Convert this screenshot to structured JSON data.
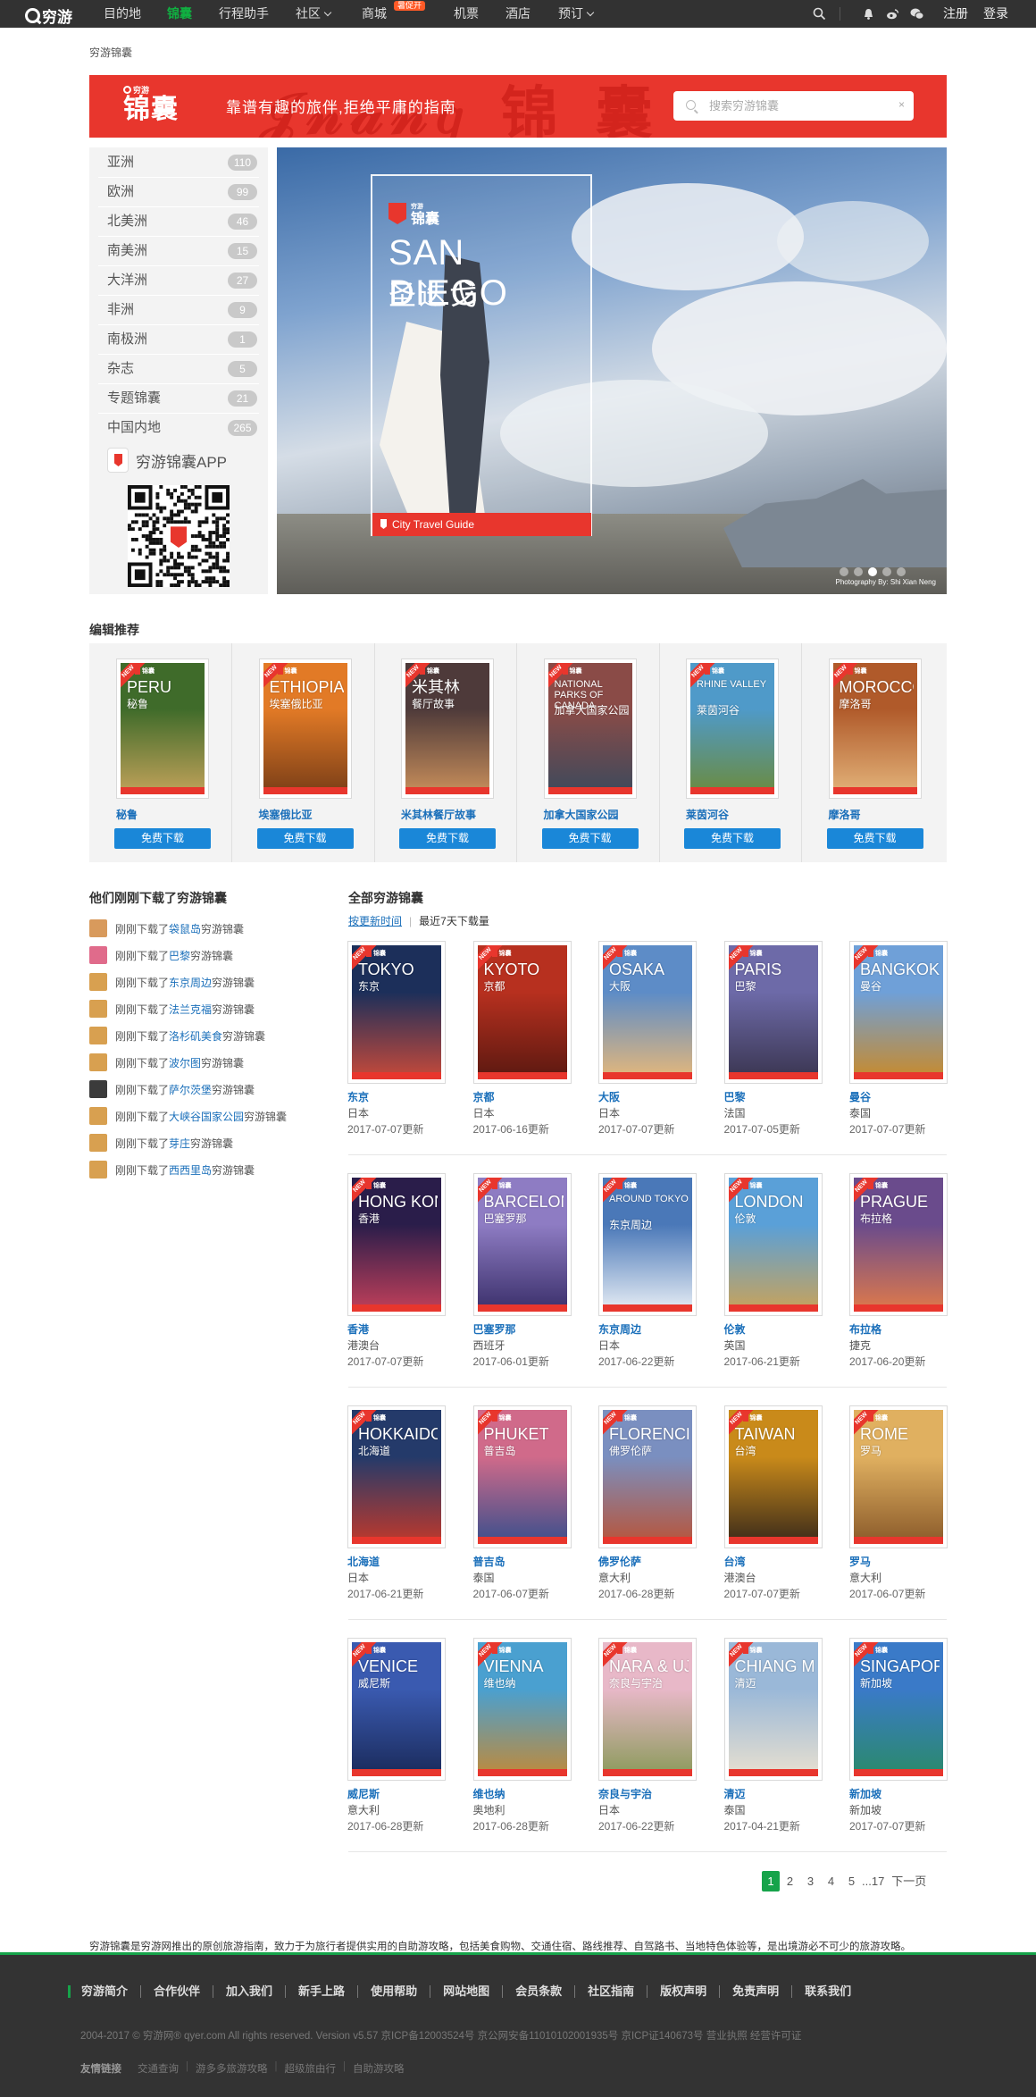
{
  "nav": {
    "logo": "穷游",
    "items": [
      {
        "label": "目的地",
        "active": false,
        "dropdown": false
      },
      {
        "label": "锦囊",
        "active": true,
        "dropdown": false
      },
      {
        "label": "行程助手",
        "active": false,
        "dropdown": false
      },
      {
        "label": "社区",
        "active": false,
        "dropdown": true
      },
      {
        "label": "商城",
        "active": false,
        "dropdown": false,
        "badge": "暑促开"
      },
      {
        "label": "机票",
        "active": false,
        "dropdown": false
      },
      {
        "label": "酒店",
        "active": false,
        "dropdown": false
      },
      {
        "label": "预订",
        "active": false,
        "dropdown": true
      }
    ],
    "register": "注册",
    "login": "登录",
    "icons": [
      "search-icon",
      "bell-icon",
      "weibo-icon",
      "wechat-icon"
    ]
  },
  "breadcrumb": "穷游锦囊",
  "banner": {
    "logo_small": "穷游",
    "logo_big": "锦囊",
    "slogan": "靠谱有趣的旅伴,拒绝平庸的指南",
    "search_placeholder": "搜索穷游锦囊",
    "clear": "×"
  },
  "categories": [
    {
      "label": "亚洲",
      "count": "110"
    },
    {
      "label": "欧洲",
      "count": "99"
    },
    {
      "label": "北美洲",
      "count": "46"
    },
    {
      "label": "南美洲",
      "count": "15"
    },
    {
      "label": "大洋洲",
      "count": "27"
    },
    {
      "label": "非洲",
      "count": "9"
    },
    {
      "label": "南极洲",
      "count": "1"
    },
    {
      "label": "杂志",
      "count": "5"
    },
    {
      "label": "专题锦囊",
      "count": "21"
    },
    {
      "label": "中国内地",
      "count": "265"
    }
  ],
  "app": {
    "label": "穷游锦囊APP"
  },
  "hero": {
    "logo_small": "穷游",
    "logo_big": "锦囊",
    "title_en": "SAN DIEGO",
    "title_cn": "圣迭戈",
    "tag": "City Travel Guide",
    "credit": "Photography By: Shi Xian Neng",
    "slide_count": 5,
    "active_slide": 3
  },
  "picks_title": "编辑推荐",
  "picks": [
    {
      "name": "秘鲁",
      "en": "PERU",
      "cn": "秘鲁",
      "button": "免费下载",
      "c1": "#3f6b2a",
      "c2": "#c2a25a"
    },
    {
      "name": "埃塞俄比亚",
      "en": "ETHIOPIA",
      "cn": "埃塞俄比亚",
      "button": "免费下载",
      "c1": "#e27a26",
      "c2": "#7a3e17"
    },
    {
      "name": "米其林餐厅故事",
      "en": "米其林",
      "cn": "餐厅故事",
      "button": "免费下载",
      "c1": "#4e3a3a",
      "c2": "#c98f5b"
    },
    {
      "name": "加拿大国家公园",
      "en": "NATIONAL PARKS OF CANADA",
      "cn": "加拿大国家公园",
      "button": "免费下载",
      "c1": "#8a4b47",
      "c2": "#3d4a5c"
    },
    {
      "name": "莱茵河谷",
      "en": "RHINE VALLEY",
      "cn": "莱茵河谷",
      "button": "免费下载",
      "c1": "#4f9ac9",
      "c2": "#6b8b3e"
    },
    {
      "name": "摩洛哥",
      "en": "MOROCCO",
      "cn": "摩洛哥",
      "button": "免费下载",
      "c1": "#b05a2a",
      "c2": "#e3b37a"
    }
  ],
  "feed_title": "他们刚刚下载了穷游锦囊",
  "feed": [
    {
      "prefix": "刚刚下载了",
      "place": "袋鼠岛",
      "suffix": "穷游锦囊",
      "avatar": "#d89a5c"
    },
    {
      "prefix": "刚刚下载了",
      "place": "巴黎",
      "suffix": "穷游锦囊",
      "avatar": "#e06b8b"
    },
    {
      "prefix": "刚刚下载了",
      "place": "东京周边",
      "suffix": "穷游锦囊",
      "avatar": "#d8a050"
    },
    {
      "prefix": "刚刚下载了",
      "place": "法兰克福",
      "suffix": "穷游锦囊",
      "avatar": "#d8a050"
    },
    {
      "prefix": "刚刚下载了",
      "place": "洛杉矶美食",
      "suffix": "穷游锦囊",
      "avatar": "#d8a050"
    },
    {
      "prefix": "刚刚下载了",
      "place": "波尔图",
      "suffix": "穷游锦囊",
      "avatar": "#d8a050"
    },
    {
      "prefix": "刚刚下载了",
      "place": "萨尔茨堡",
      "suffix": "穷游锦囊",
      "avatar": "#3b3b3b"
    },
    {
      "prefix": "刚刚下载了",
      "place": "大峡谷国家公园",
      "suffix": "穷游锦囊",
      "avatar": "#d8a050"
    },
    {
      "prefix": "刚刚下载了",
      "place": "芽庄",
      "suffix": "穷游锦囊",
      "avatar": "#d8a050"
    },
    {
      "prefix": "刚刚下载了",
      "place": "西西里岛",
      "suffix": "穷游锦囊",
      "avatar": "#d8a050"
    }
  ],
  "all_title": "全部穷游锦囊",
  "sort": {
    "by_time": "按更新时间",
    "by_downloads": "最近7天下载量"
  },
  "guides": [
    {
      "name": "东京",
      "country": "日本",
      "date": "2017-07-07更新",
      "en": "TOKYO",
      "cn": "东京",
      "c1": "#1c2f5a",
      "c2": "#c84a3a"
    },
    {
      "name": "京都",
      "country": "日本",
      "date": "2017-06-16更新",
      "en": "KYOTO",
      "cn": "京都",
      "c1": "#b7301f",
      "c2": "#5a1810"
    },
    {
      "name": "大阪",
      "country": "日本",
      "date": "2017-07-07更新",
      "en": "OSAKA",
      "cn": "大阪",
      "c1": "#5d8cc7",
      "c2": "#e6b87a"
    },
    {
      "name": "巴黎",
      "country": "法国",
      "date": "2017-07-05更新",
      "en": "PARIS",
      "cn": "巴黎",
      "c1": "#6d6aa8",
      "c2": "#3a3550"
    },
    {
      "name": "曼谷",
      "country": "泰国",
      "date": "2017-07-07更新",
      "en": "BANGKOK",
      "cn": "曼谷",
      "c1": "#6fa0d8",
      "c2": "#c98a2a"
    },
    {
      "name": "香港",
      "country": "港澳台",
      "date": "2017-07-07更新",
      "en": "HONG KONG",
      "cn": "香港",
      "c1": "#2a1d4a",
      "c2": "#c2405a"
    },
    {
      "name": "巴塞罗那",
      "country": "西班牙",
      "date": "2017-06-01更新",
      "en": "BARCELONA",
      "cn": "巴塞罗那",
      "c1": "#8e7cc3",
      "c2": "#3a2f6a"
    },
    {
      "name": "东京周边",
      "country": "日本",
      "date": "2017-06-22更新",
      "en": "AROUND TOKYO",
      "cn": "东京周边",
      "c1": "#4a78b8",
      "c2": "#e8eef5"
    },
    {
      "name": "伦敦",
      "country": "英国",
      "date": "2017-06-21更新",
      "en": "LONDON",
      "cn": "伦敦",
      "c1": "#5aa0d8",
      "c2": "#c9a35a"
    },
    {
      "name": "布拉格",
      "country": "捷克",
      "date": "2017-06-20更新",
      "en": "PRAGUE",
      "cn": "布拉格",
      "c1": "#6a4b8c",
      "c2": "#e07a4a"
    },
    {
      "name": "北海道",
      "country": "日本",
      "date": "2017-06-21更新",
      "en": "HOKKAIDO",
      "cn": "北海道",
      "c1": "#243a6a",
      "c2": "#c0392b"
    },
    {
      "name": "普吉岛",
      "country": "泰国",
      "date": "2017-06-07更新",
      "en": "PHUKET",
      "cn": "普吉岛",
      "c1": "#d06a8a",
      "c2": "#3a4f8c"
    },
    {
      "name": "佛罗伦萨",
      "country": "意大利",
      "date": "2017-06-28更新",
      "en": "FLORENCE",
      "cn": "佛罗伦萨",
      "c1": "#7a8fc0",
      "c2": "#b8553a"
    },
    {
      "name": "台湾",
      "country": "港澳台",
      "date": "2017-07-07更新",
      "en": "TAIWAN",
      "cn": "台湾",
      "c1": "#c98a1a",
      "c2": "#3a2a1a"
    },
    {
      "name": "罗马",
      "country": "意大利",
      "date": "2017-06-07更新",
      "en": "ROME",
      "cn": "罗马",
      "c1": "#e0b060",
      "c2": "#8a5a2a"
    },
    {
      "name": "威尼斯",
      "country": "意大利",
      "date": "2017-06-28更新",
      "en": "VENICE",
      "cn": "威尼斯",
      "c1": "#3a5ab0",
      "c2": "#1a2a5a"
    },
    {
      "name": "维也纳",
      "country": "奥地利",
      "date": "2017-06-28更新",
      "en": "VIENNA",
      "cn": "维也纳",
      "c1": "#4aa0d0",
      "c2": "#c08a3a"
    },
    {
      "name": "奈良与宇治",
      "country": "日本",
      "date": "2017-06-22更新",
      "en": "NARA & UJI",
      "cn": "奈良与宇治",
      "c1": "#e8b8c8",
      "c2": "#8a9a5a"
    },
    {
      "name": "清迈",
      "country": "泰国",
      "date": "2017-04-21更新",
      "en": "CHIANG MAI",
      "cn": "清迈",
      "c1": "#9ab8d8",
      "c2": "#e8e0d0"
    },
    {
      "name": "新加坡",
      "country": "新加坡",
      "date": "2017-07-07更新",
      "en": "SINGAPORE",
      "cn": "新加坡",
      "c1": "#3a7ac8",
      "c2": "#2a8a6a"
    }
  ],
  "pagination": {
    "pages": [
      "1",
      "2",
      "3",
      "4",
      "5",
      "...17"
    ],
    "current": "1",
    "next": "下一页"
  },
  "description": "穷游锦囊是穷游网推出的原创旅游指南，致力于为旅行者提供实用的自助游攻略，包括美食购物、交通住宿、路线推荐、自驾路书、当地特色体验等，是出境游必不可少的旅游攻略。",
  "footer": {
    "links": [
      "穷游简介",
      "合作伙伴",
      "加入我们",
      "新手上路",
      "使用帮助",
      "网站地图",
      "会员条款",
      "社区指南",
      "版权声明",
      "免责声明",
      "联系我们"
    ],
    "copyright": "2004-2017 © 穷游网® qyer.com All rights reserved. Version v5.57  京ICP备12003524号  京公网安备11010102001935号  京ICP证140673号  营业执照  经营许可证",
    "friend_title": "友情链接",
    "friend_links": [
      "交通查询",
      "游多多旅游攻略",
      "超级旅由行",
      "自助游攻略"
    ]
  }
}
